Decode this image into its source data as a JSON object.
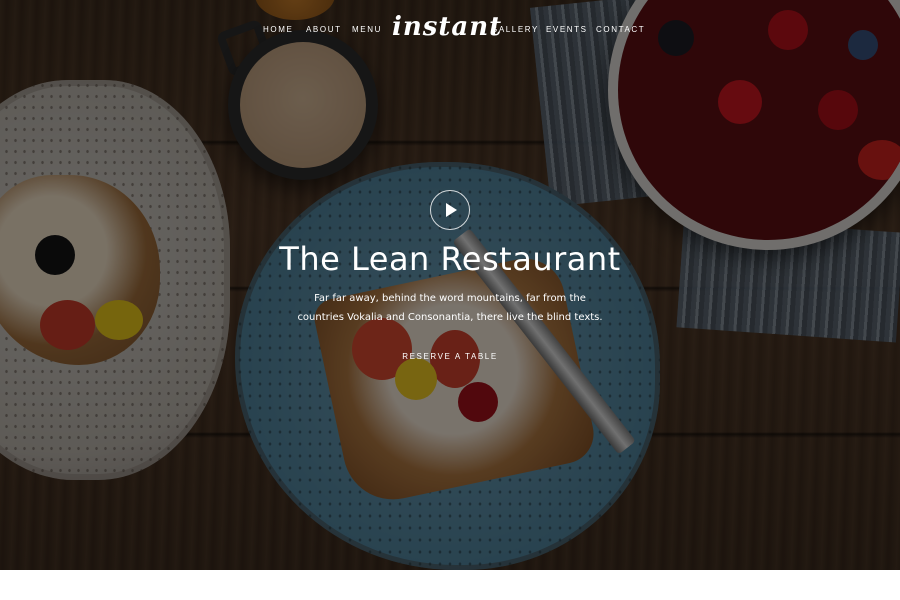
{
  "nav": {
    "items_left": [
      "Home",
      "About",
      "Menu"
    ],
    "brand": "instant",
    "items_right": [
      "Gallery",
      "Events",
      "Contact"
    ]
  },
  "hero": {
    "play_icon": "play-icon",
    "title": "The Lean Restaurant",
    "subtitle": "Far far away, behind the word mountains, far from the countries Vokalia and Consonantia, there live the blind texts.",
    "cta": "Reserve a Table"
  },
  "colors": {
    "text": "#ffffff",
    "overlay": "rgba(0,0,0,0.48)"
  }
}
